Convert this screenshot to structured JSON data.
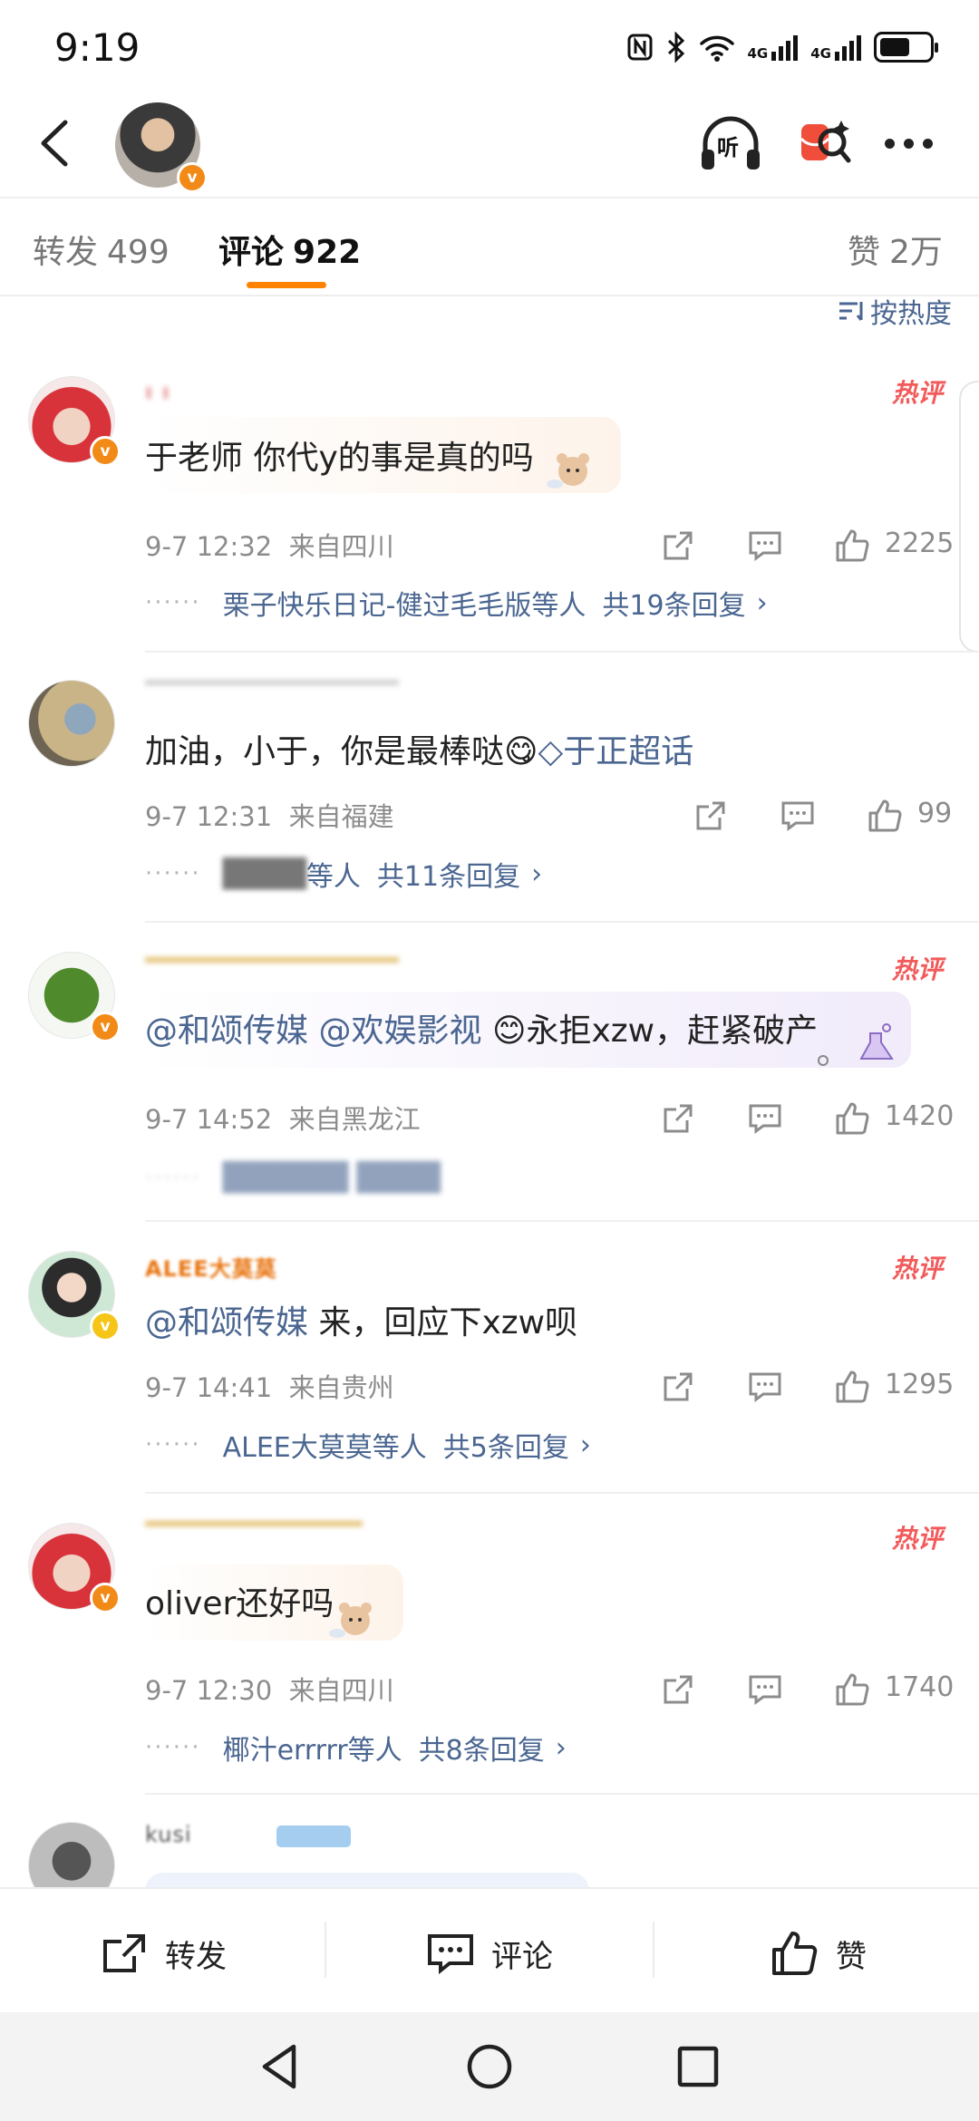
{
  "status": {
    "time": "9:19",
    "net1": "4G",
    "net2": "4G"
  },
  "header": {
    "listen_label": "听"
  },
  "tabs": [
    {
      "label": "转发",
      "count": "499"
    },
    {
      "label": "评论",
      "count": "922"
    },
    {
      "label": "赞",
      "count": "2万"
    }
  ],
  "sort": {
    "label": "按热度"
  },
  "comments": [
    {
      "hot": "热评",
      "text": "于老师 你代y的事是真的吗",
      "date": "9-7 12:32",
      "location": "来自四川",
      "likes": "2225",
      "reply_users": "栗子快乐日记-健过毛毛版等人",
      "reply_total": "共19条回复"
    },
    {
      "text": "加油，小于，你是最棒哒",
      "emoji": "😋",
      "topic": "于正超话",
      "date": "9-7 12:31",
      "location": "来自福建",
      "likes": "99",
      "reply_users": "等人",
      "reply_total": "共11条回复"
    },
    {
      "hot": "热评",
      "mention1": "@和颂传媒",
      "mention2": "@欢娱影视",
      "emoji": "😊",
      "text": "永拒xzw，赶紧破产",
      "date": "9-7 14:52",
      "location": "来自黑龙江",
      "likes": "1420"
    },
    {
      "hot": "热评",
      "name": "ALEE大莫莫",
      "mention": "@和颂传媒",
      "text": " 来，回应下xzw呗",
      "date": "9-7 14:41",
      "location": "来自贵州",
      "likes": "1295",
      "reply_users": "ALEE大莫莫等人",
      "reply_total": "共5条回复"
    },
    {
      "hot": "热评",
      "text": "oliver还好吗",
      "date": "9-7 12:30",
      "location": "来自四川",
      "likes": "1740",
      "reply_users": "椰汁errrrr等人",
      "reply_total": "共8条回复"
    }
  ],
  "bottom_bar": {
    "repost": "转发",
    "comment": "评论",
    "like": "赞"
  },
  "colors": {
    "accent": "#ff8200",
    "link": "#4a6691",
    "hot": "#f25b5b",
    "vip": "#f28a17"
  }
}
